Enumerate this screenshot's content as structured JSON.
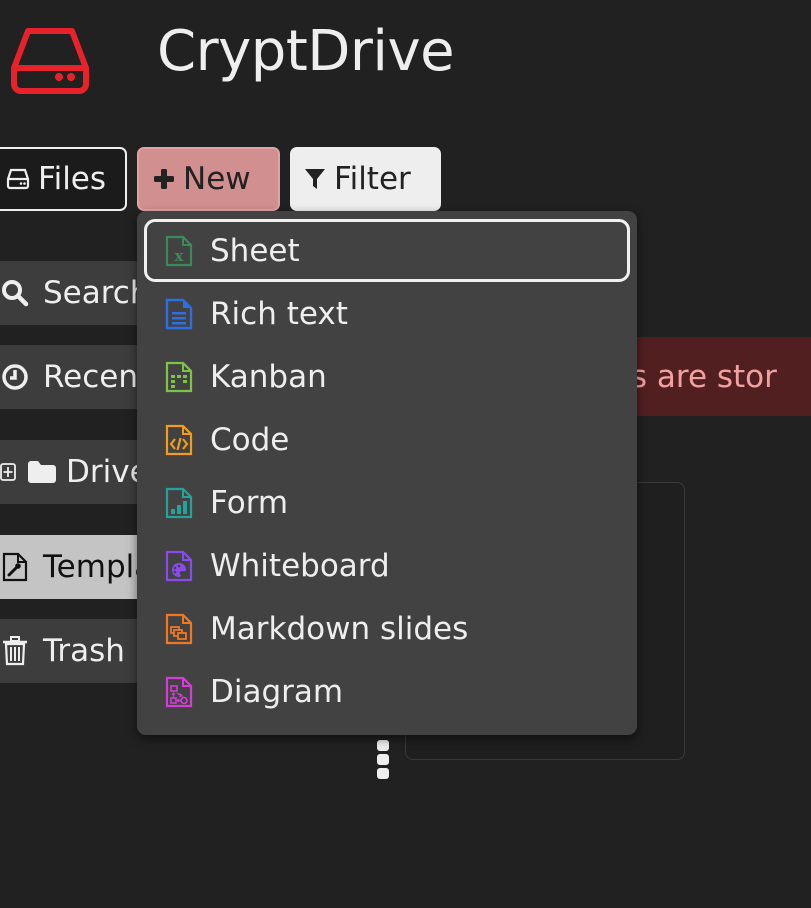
{
  "app": {
    "title": "CryptDrive",
    "logo_icon": "drive-icon",
    "brand_color": "#e8222a"
  },
  "toolbar": {
    "files_label": "Files",
    "files_icon": "drive-icon",
    "new_label": "New",
    "new_icon": "plus-icon",
    "filter_label": "Filter",
    "filter_icon": "filter-icon"
  },
  "sidebar": {
    "items": [
      {
        "label": "Search",
        "icon": "search-icon"
      },
      {
        "label": "Recent",
        "icon": "clock-icon"
      },
      {
        "label": "Drive",
        "icon": "folder-icon",
        "expand_icon": "plus-square-icon"
      },
      {
        "label": "Templates",
        "icon": "file-wrench-icon",
        "active": true
      },
      {
        "label": "Trash",
        "icon": "trash-icon"
      }
    ]
  },
  "banner": {
    "text": "ents are stor"
  },
  "new_menu": {
    "items": [
      {
        "label": "Sheet",
        "icon": "sheet-icon",
        "color": "#3b8a5a",
        "focused": true
      },
      {
        "label": "Rich text",
        "icon": "richtext-icon",
        "color": "#2d6ee0"
      },
      {
        "label": "Kanban",
        "icon": "kanban-icon",
        "color": "#7cc443"
      },
      {
        "label": "Code",
        "icon": "code-icon",
        "color": "#f09d1c"
      },
      {
        "label": "Form",
        "icon": "form-icon",
        "color": "#25a39b"
      },
      {
        "label": "Whiteboard",
        "icon": "whiteboard-icon",
        "color": "#8a4af0"
      },
      {
        "label": "Markdown slides",
        "icon": "slides-icon",
        "color": "#f07820"
      },
      {
        "label": "Diagram",
        "icon": "diagram-icon",
        "color": "#d23ed6"
      }
    ]
  }
}
